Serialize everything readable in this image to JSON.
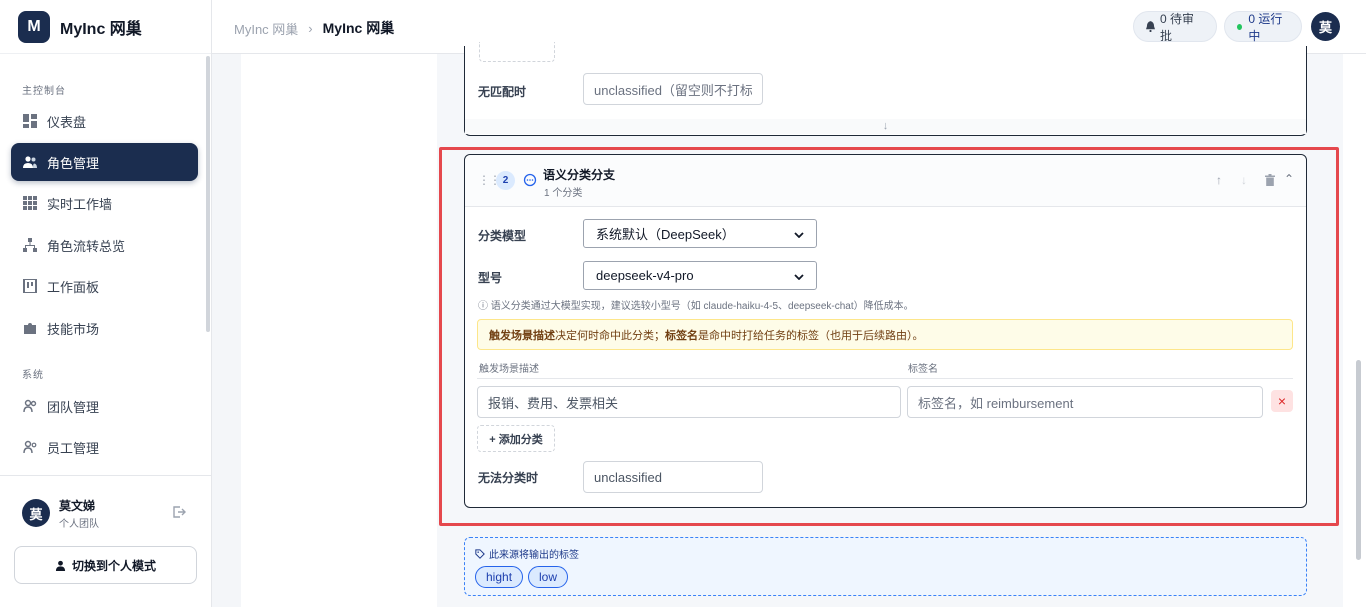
{
  "brand": {
    "logo_letter": "M",
    "name": "MyInc 网巢"
  },
  "sidebar": {
    "section_main": "主控制台",
    "section_system": "系统",
    "items": [
      {
        "label": "仪表盘",
        "icon": "dashboard-icon"
      },
      {
        "label": "角色管理",
        "icon": "users-icon",
        "active": true
      },
      {
        "label": "实时工作墙",
        "icon": "grid-icon"
      },
      {
        "label": "角色流转总览",
        "icon": "hierarchy-icon"
      },
      {
        "label": "工作面板",
        "icon": "board-icon"
      },
      {
        "label": "技能市场",
        "icon": "puzzle-icon"
      },
      {
        "label": "团队管理",
        "icon": "team-icon"
      },
      {
        "label": "员工管理",
        "icon": "employees-icon"
      }
    ],
    "user": {
      "avatar": "莫",
      "name": "莫文娣",
      "team": "个人团队"
    },
    "switch_label": "切换到个人模式"
  },
  "topbar": {
    "crumb_root": "MyInc 网巢",
    "crumb_current": "MyInc 网巢",
    "pending_label": "0 待审批",
    "running_label": "0 运行中",
    "avatar": "莫"
  },
  "prev_card": {
    "no_match_label": "无匹配时",
    "no_match_placeholder": "unclassified（留空则不打标签"
  },
  "semantic_card": {
    "index": "2",
    "title": "语义分类分支",
    "subtitle": "1 个分类",
    "model_label": "分类模型",
    "model_value": "系统默认（DeepSeek）",
    "type_label": "型号",
    "type_value": "deepseek-v4-pro",
    "hint": "ⓘ 语义分类通过大模型实现，建议选较小型号（如 claude-haiku-4-5、deepseek-chat）降低成本。",
    "notice_b1": "触发场景描述",
    "notice_t1": "决定何时命中此分类；",
    "notice_b2": "标签名",
    "notice_t2": "是命中时打给任务的标签（也用于后续路由）。",
    "col_desc": "触发场景描述",
    "col_tag": "标签名",
    "desc_value": "报销、费用、发票相关",
    "tag_placeholder": "标签名，如 reimbursement",
    "add_label": "+ 添加分类",
    "fallback_label": "无法分类时",
    "fallback_value": "unclassified"
  },
  "output_box": {
    "title": "此来源将输出的标签",
    "tags": [
      "hight",
      "low"
    ]
  },
  "colors": {
    "brand": "#1b2d4f",
    "highlight": "#e5484d",
    "notice_bg": "#fefce8",
    "tag_bg": "#dbeafe"
  }
}
